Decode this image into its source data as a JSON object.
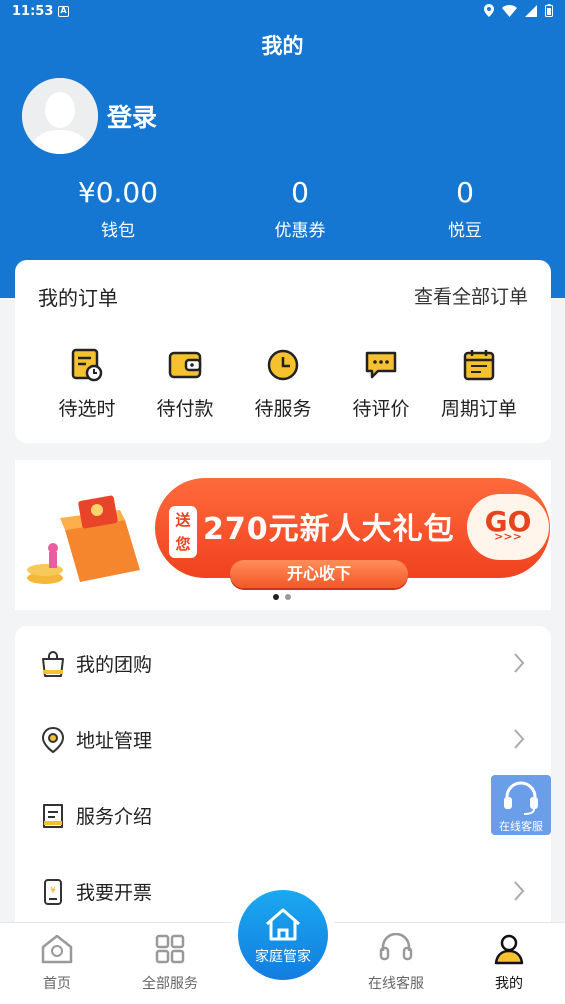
{
  "status_bar": {
    "time": "11:53",
    "app_indicator": "A"
  },
  "header": {
    "title": "我的",
    "login_label": "登录",
    "stats": [
      {
        "value": "¥0.00",
        "label": "钱包"
      },
      {
        "value": "0",
        "label": "优惠券"
      },
      {
        "value": "0",
        "label": "悦豆"
      }
    ]
  },
  "orders": {
    "title": "我的订单",
    "view_all": "查看全部订单",
    "items": [
      {
        "label": "待选时",
        "icon": "schedule-icon"
      },
      {
        "label": "待付款",
        "icon": "wallet-icon"
      },
      {
        "label": "待服务",
        "icon": "clock-icon"
      },
      {
        "label": "待评价",
        "icon": "comment-icon"
      },
      {
        "label": "周期订单",
        "icon": "calendar-icon"
      }
    ]
  },
  "banner": {
    "send_text": "送您",
    "headline": "270元新人大礼包",
    "go": "GO",
    "go_sub": ">>>",
    "button": "开心收下",
    "slide_count": 2,
    "active_slide": 1
  },
  "menu": {
    "items": [
      {
        "label": "我的团购",
        "icon": "shopping-bag-icon"
      },
      {
        "label": "地址管理",
        "icon": "location-icon"
      },
      {
        "label": "服务介绍",
        "icon": "document-icon"
      },
      {
        "label": "我要开票",
        "icon": "invoice-icon"
      }
    ]
  },
  "float_service": {
    "label": "在线客服"
  },
  "bottom_nav": {
    "items": [
      {
        "label": "首页"
      },
      {
        "label": "全部服务"
      },
      {
        "label": "家庭管家"
      },
      {
        "label": "在线客服"
      },
      {
        "label": "我的"
      }
    ],
    "active_index": 4
  },
  "colors": {
    "primary": "#1677d2",
    "icon_yellow": "#f5c12e",
    "banner_red": "#f0421f"
  }
}
